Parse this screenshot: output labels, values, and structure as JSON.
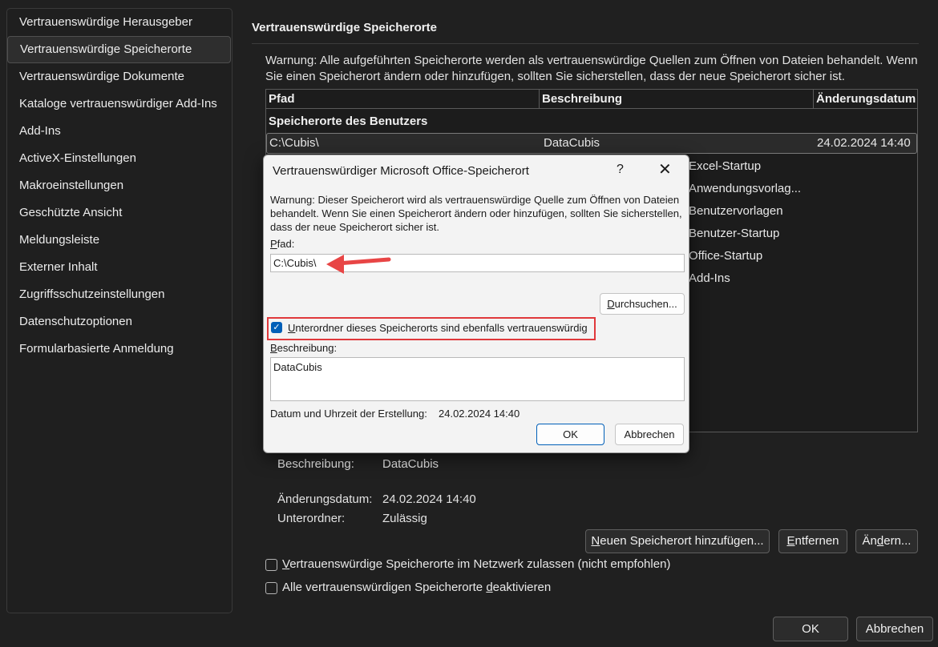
{
  "sidebar": {
    "items": [
      {
        "label": "Vertrauenswürdige Herausgeber"
      },
      {
        "label": "Vertrauenswürdige Speicherorte"
      },
      {
        "label": "Vertrauenswürdige Dokumente"
      },
      {
        "label": "Kataloge vertrauenswürdiger Add-Ins"
      },
      {
        "label": "Add-Ins"
      },
      {
        "label": "ActiveX-Einstellungen"
      },
      {
        "label": "Makroeinstellungen"
      },
      {
        "label": "Geschützte Ansicht"
      },
      {
        "label": "Meldungsleiste"
      },
      {
        "label": "Externer Inhalt"
      },
      {
        "label": "Zugriffsschutzeinstellungen"
      },
      {
        "label": "Datenschutzoptionen"
      },
      {
        "label": "Formularbasierte Anmeldung"
      }
    ],
    "selected_index": 1
  },
  "main": {
    "title": "Vertrauenswürdige Speicherorte",
    "warning_line1": "Warnung: Alle aufgeführten Speicherorte werden als vertrauenswürdige Quellen zum Öffnen von Dateien behandelt. Wenn",
    "warning_line2": "Sie einen Speicherort ändern oder hinzufügen, sollten Sie sicherstellen, dass der neue Speicherort sicher ist.",
    "columns": [
      "Pfad",
      "Beschreibung",
      "Änderungsdatum"
    ],
    "group_header": "Speicherorte des Benutzers",
    "selected_row": {
      "path": "C:\\Cubis\\",
      "description": "DataCubis",
      "date": "24.02.2024 14:40"
    },
    "partial_descriptions": [
      "Excel-Startup",
      "Anwendungsvorlag...",
      "Benutzervorlagen",
      "Benutzer-Startup",
      "Office-Startup",
      "Add-Ins"
    ],
    "details": {
      "description_label": "Beschreibung:",
      "description_value": "DataCubis",
      "date_label": "Änderungsdatum:",
      "date_value": "24.02.2024 14:40",
      "sub_label": "Unterordner:",
      "sub_value": "Zulässig"
    },
    "buttons": {
      "add_u": "N",
      "add_rest": "euen Speicherort hinzufügen...",
      "remove_u": "E",
      "remove_rest": "ntfernen",
      "change_pre": "Än",
      "change_u": "d",
      "change_rest": "ern..."
    },
    "network_check": {
      "checked": false,
      "label_u": "V",
      "label_rest": "ertrauenswürdige Speicherorte im Netzwerk zulassen (nicht empfohlen)"
    },
    "disable_check": {
      "checked": false,
      "label_pre": "Alle vertrauenswürdigen Speicherorte ",
      "label_u": "d",
      "label_rest": "eaktivieren"
    },
    "ok": "OK",
    "cancel": "Abbrechen"
  },
  "dialog": {
    "title": "Vertrauenswürdiger Microsoft Office-Speicherort",
    "help": "?",
    "close": "✕",
    "warning_line1": "Warnung: Dieser Speicherort wird als vertrauenswürdige Quelle zum Öffnen von Dateien",
    "warning_line2": "behandelt. Wenn Sie einen Speicherort ändern oder hinzufügen, sollten Sie sicherstellen,",
    "warning_line3": "dass der neue Speicherort sicher ist.",
    "path_label_u": "P",
    "path_label_rest": "fad:",
    "path_value": "C:\\Cubis\\",
    "browse_u": "D",
    "browse_rest": "urchsuchen...",
    "subfolders_checked": true,
    "subfolders_u": "U",
    "subfolders_rest": "nterordner dieses Speicherorts sind ebenfalls vertrauenswürdig",
    "desc_label_u": "B",
    "desc_label_rest": "eschreibung:",
    "desc_value": "DataCubis",
    "created_label": "Datum und Uhrzeit der Erstellung:",
    "created_value": "24.02.2024 14:40",
    "ok": "OK",
    "cancel": "Abbrechen"
  },
  "colors": {
    "highlight": "#e0383b",
    "arrow": "#e84545",
    "checkbox": "#005fb8"
  }
}
